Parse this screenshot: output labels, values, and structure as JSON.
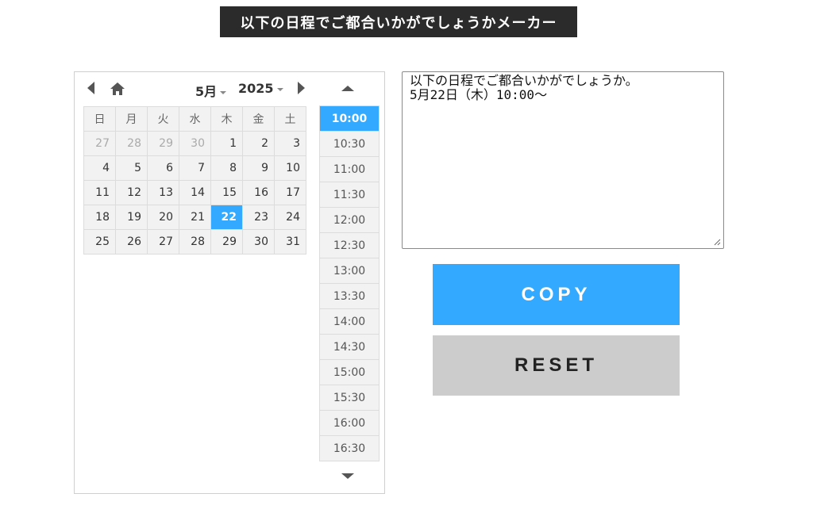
{
  "title": "以下の日程でご都合いかがでしょうかメーカー",
  "calendar": {
    "month_label": "5月",
    "year_label": "2025",
    "weekdays": [
      "日",
      "月",
      "火",
      "水",
      "木",
      "金",
      "土"
    ],
    "weeks": [
      [
        {
          "d": "27",
          "other": true
        },
        {
          "d": "28",
          "other": true
        },
        {
          "d": "29",
          "other": true
        },
        {
          "d": "30",
          "other": true
        },
        {
          "d": "1"
        },
        {
          "d": "2"
        },
        {
          "d": "3"
        }
      ],
      [
        {
          "d": "4"
        },
        {
          "d": "5"
        },
        {
          "d": "6"
        },
        {
          "d": "7"
        },
        {
          "d": "8"
        },
        {
          "d": "9"
        },
        {
          "d": "10"
        }
      ],
      [
        {
          "d": "11"
        },
        {
          "d": "12"
        },
        {
          "d": "13"
        },
        {
          "d": "14"
        },
        {
          "d": "15"
        },
        {
          "d": "16"
        },
        {
          "d": "17"
        }
      ],
      [
        {
          "d": "18"
        },
        {
          "d": "19"
        },
        {
          "d": "20"
        },
        {
          "d": "21"
        },
        {
          "d": "22",
          "selected": true
        },
        {
          "d": "23"
        },
        {
          "d": "24"
        }
      ],
      [
        {
          "d": "25"
        },
        {
          "d": "26"
        },
        {
          "d": "27"
        },
        {
          "d": "28"
        },
        {
          "d": "29"
        },
        {
          "d": "30"
        },
        {
          "d": "31"
        }
      ]
    ]
  },
  "times": [
    "10:00",
    "10:30",
    "11:00",
    "11:30",
    "12:00",
    "12:30",
    "13:00",
    "13:30",
    "14:00",
    "14:30",
    "15:00",
    "15:30",
    "16:00",
    "16:30"
  ],
  "selected_time": "10:00",
  "output_text": "以下の日程でご都合いかがでしょうか。\n5月22日（木）10:00～",
  "buttons": {
    "copy": "COPY",
    "reset": "RESET"
  },
  "colors": {
    "accent": "#33aaff",
    "title_bg": "#2b2b2b",
    "reset_bg": "#cccccc"
  },
  "icons": {
    "prev": "caret-left-icon",
    "home": "home-icon",
    "next": "caret-right-icon",
    "up": "caret-up-icon",
    "down": "caret-down-icon"
  }
}
